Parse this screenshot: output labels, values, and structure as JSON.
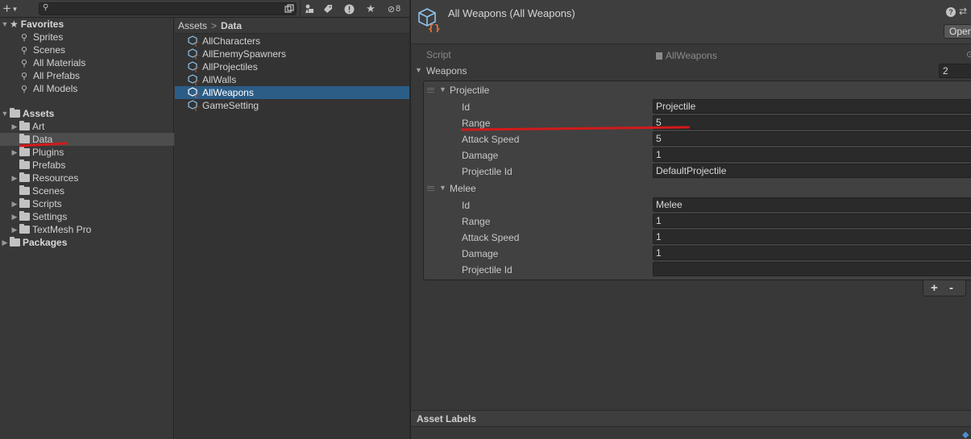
{
  "project": {
    "toolbar": {
      "create_label": "+",
      "hidden_count": "8"
    },
    "favorites": {
      "title": "Favorites",
      "items": [
        "Sprites",
        "Scenes",
        "All Materials",
        "All Prefabs",
        "All Models"
      ]
    },
    "assets_tree": {
      "title": "Assets",
      "folders": [
        "Art",
        "Data",
        "Plugins",
        "Prefabs",
        "Resources",
        "Scenes",
        "Scripts",
        "Settings",
        "TextMesh Pro"
      ],
      "selected": "Data"
    },
    "packages": {
      "title": "Packages"
    },
    "breadcrumb": {
      "root": "Assets",
      "separator": ">",
      "current": "Data"
    },
    "files": [
      "AllCharacters",
      "AllEnemySpawners",
      "AllProjectiles",
      "AllWalls",
      "AllWeapons",
      "GameSetting"
    ],
    "selected_file": "AllWeapons"
  },
  "inspector": {
    "title": "All Weapons (All Weapons)",
    "open_button": "Open",
    "script_label": "Script",
    "script_value": "AllWeapons",
    "weapons_label": "Weapons",
    "weapons_count": "2",
    "elements": [
      {
        "name": "Projectile",
        "id_label": "Id",
        "id": "Projectile",
        "range_label": "Range",
        "range": "5",
        "attack_speed_label": "Attack Speed",
        "attack_speed": "5",
        "damage_label": "Damage",
        "damage": "1",
        "projectile_id_label": "Projectile Id",
        "projectile_id": "DefaultProjectile"
      },
      {
        "name": "Melee",
        "id_label": "Id",
        "id": "Melee",
        "range_label": "Range",
        "range": "1",
        "attack_speed_label": "Attack Speed",
        "attack_speed": "1",
        "damage_label": "Damage",
        "damage": "1",
        "projectile_id_label": "Projectile Id",
        "projectile_id": ""
      }
    ],
    "add_label": "+",
    "remove_label": "-",
    "asset_labels": "Asset Labels"
  },
  "colors": {
    "selection_blue": "#2c5d87",
    "annotation_red": "#d21a1a",
    "json_icon_orange": "#e8733a",
    "cube_icon_blue": "#8fc3ea"
  }
}
